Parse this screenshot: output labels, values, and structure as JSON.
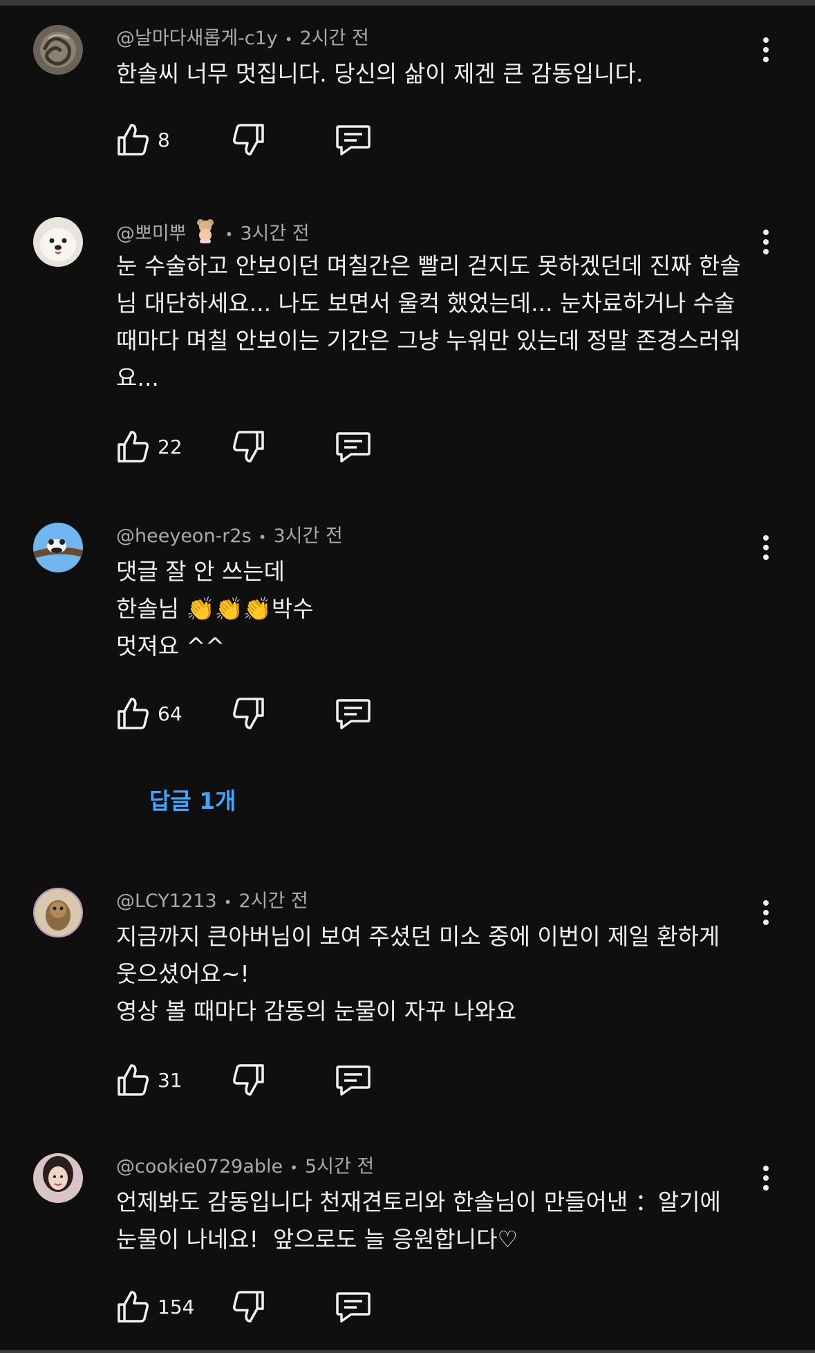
{
  "comments": [
    {
      "handle": "@날마다새롭게-c1y",
      "time": "2시간 전",
      "text": "한솔씨 너무 멋집니다. 당신의 삶이 제겐 큰 감동입니다.",
      "likes": "8"
    },
    {
      "handle": "@뽀미뿌",
      "time": "3시간 전",
      "text": "눈 수술하고 안보이던 며칠간은 빨리 걷지도 못하겠던데 진짜 한솔\n님 대단하세요... 나도 보면서 울컥 했었는데... 눈차료하거나 수술\n때마다 며칠 안보이는 기간은 그냥 누워만 있는데 정말 존경스러워\n요...",
      "likes": "22"
    },
    {
      "handle": "@heeyeon-r2s",
      "time": "3시간 전",
      "text": "댓글 잘 안 쓰는데\n한솔님 👏👏👏박수\n멋져요 ^^",
      "likes": "64",
      "replies": "답글 1개"
    },
    {
      "handle": "@LCY1213",
      "time": "2시간 전",
      "text": "지금까지 큰아버님이 보여 주셨던 미소 중에 이번이 제일 환하게\n웃으셨어요~!\n영상 볼 때마다 감동의 눈물이 자꾸 나와요",
      "likes": "31"
    },
    {
      "handle": "@cookie0729able",
      "time": "5시간 전",
      "text": "언제봐도 감동입니다 천재견토리와 한솔님이 만들어낸 ：알기에\n눈물이 나네요!  앞으로도 늘 응원합니다♡",
      "likes": "154"
    }
  ],
  "icons": {
    "like": "thumbs-up-icon",
    "dislike": "thumbs-down-icon",
    "reply": "comment-icon",
    "more": "more-vert-icon"
  },
  "colors": {
    "background": "#0f0f0f",
    "text": "#f1f1f1",
    "secondary": "#aaaaaa",
    "link": "#3ea6ff"
  }
}
